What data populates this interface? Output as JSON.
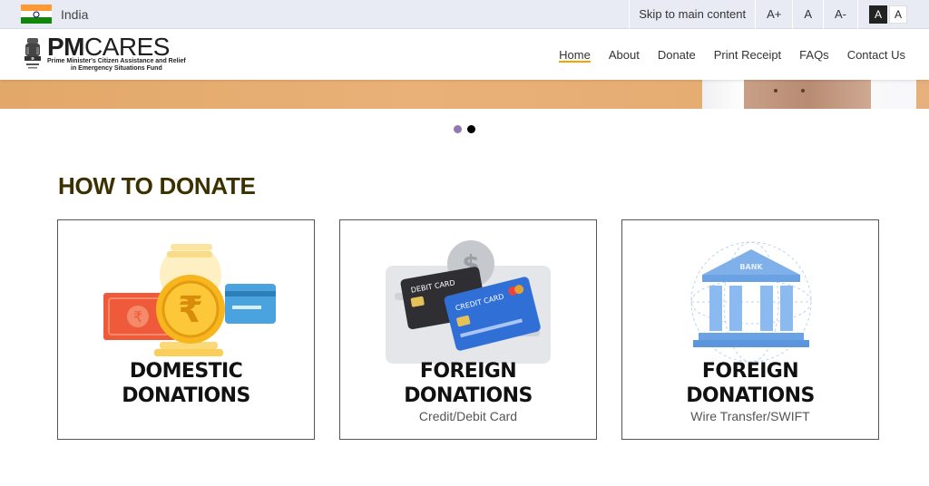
{
  "topbar": {
    "country": "India",
    "skip": "Skip to main content",
    "font_increase": "A+",
    "font_normal": "A",
    "font_decrease": "A-",
    "contrast_dark": "A",
    "contrast_light": "A"
  },
  "brand": {
    "name_bold": "PM",
    "name_light": "CARES",
    "subtitle_line1": "Prime Minister's Citizen Assistance and Relief",
    "subtitle_line2": "in Emergency Situations Fund"
  },
  "nav": {
    "items": [
      {
        "label": "Home",
        "active": true
      },
      {
        "label": "About"
      },
      {
        "label": "Donate"
      },
      {
        "label": "Print Receipt"
      },
      {
        "label": "FAQs"
      },
      {
        "label": "Contact Us"
      }
    ]
  },
  "carousel": {
    "slide_count": 2,
    "active_index": 1
  },
  "section": {
    "title": "HOW TO DONATE"
  },
  "cards": [
    {
      "title_line1": "DOMESTIC",
      "title_line2": "DONATIONS",
      "subtitle": "",
      "icon": "rupee-coin-icon"
    },
    {
      "title_line1": "FOREIGN",
      "title_line2": "DONATIONS",
      "subtitle": "Credit/Debit Card",
      "icon": "credit-card-icon",
      "card_label_1": "DEBIT CARD",
      "card_label_2": "CREDIT CARD"
    },
    {
      "title_line1": "FOREIGN",
      "title_line2": "DONATIONS",
      "subtitle": "Wire Transfer/SWIFT",
      "icon": "bank-icon",
      "bank_label": "BANK"
    }
  ],
  "colors": {
    "accent": "#f0a500",
    "title": "#3c2f00",
    "dot_inactive": "#8f79b0"
  }
}
